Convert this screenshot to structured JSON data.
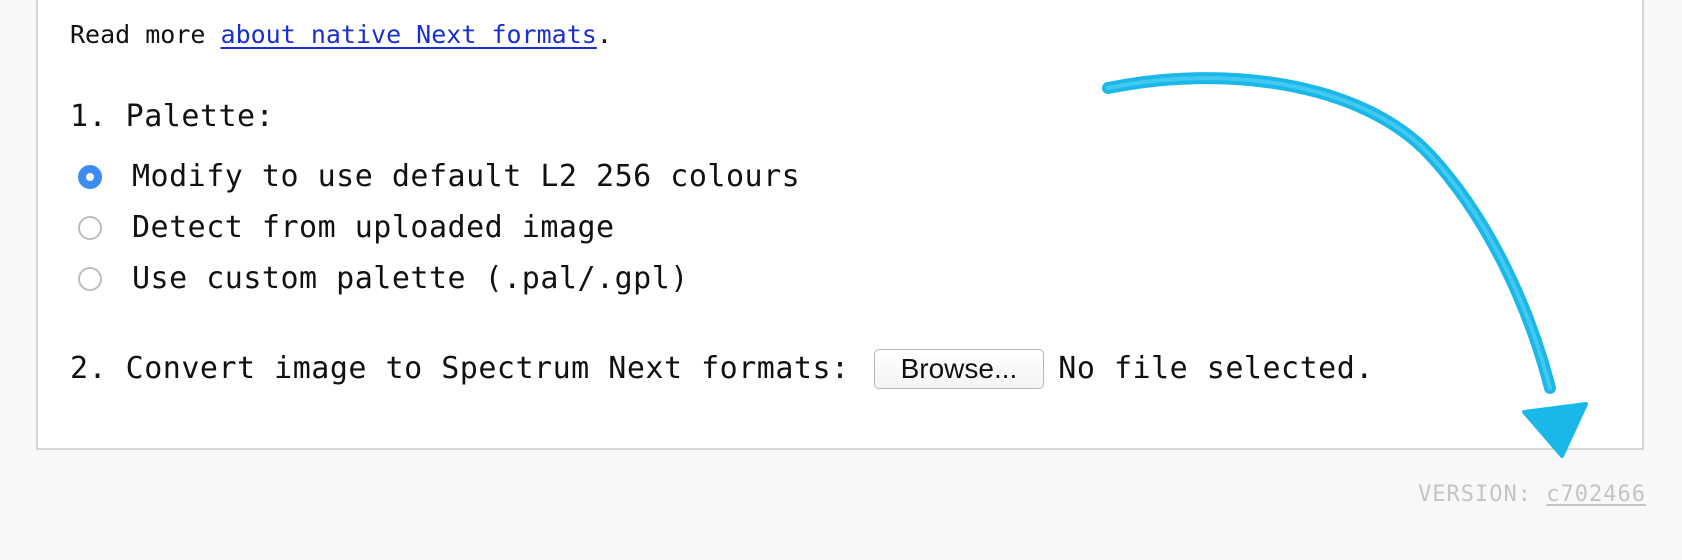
{
  "read_more": {
    "prefix": "Read more ",
    "link_text": "about native Next formats",
    "suffix": "."
  },
  "palette": {
    "heading": "1. Palette:",
    "options": [
      {
        "label": "Modify to use default L2 256 colours",
        "checked": true
      },
      {
        "label": "Detect from uploaded image",
        "checked": false
      },
      {
        "label": "Use custom palette (.pal/.gpl)",
        "checked": false
      }
    ]
  },
  "convert": {
    "label": "2. Convert image to Spectrum Next formats:",
    "browse_label": "Browse...",
    "file_status": "No file selected."
  },
  "footer": {
    "version_label": "VERSION: ",
    "version_hash": "c702466"
  },
  "colors": {
    "accent_radio": "#3b8df2",
    "link": "#1a2fd2",
    "arrow": "#1ab8e8"
  },
  "icons": {
    "annotation_arrow": "curved-arrow-icon"
  }
}
